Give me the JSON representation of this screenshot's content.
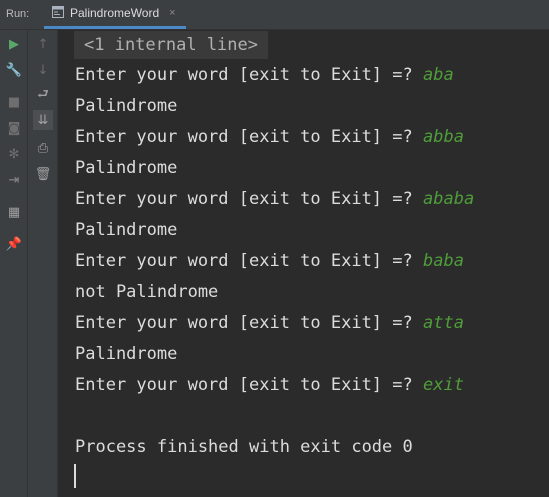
{
  "run": {
    "label": "Run:",
    "tab": {
      "title": "PalindromeWord",
      "close_glyph": "×",
      "icon": "console-icon"
    }
  },
  "left_toolbar": [
    {
      "name": "run-icon",
      "glyph": "▶",
      "color": "#59a869"
    },
    {
      "name": "wrench-icon",
      "glyph": "🔧",
      "color": "#9a9a9a"
    },
    {
      "name": "stop-icon",
      "glyph": "■",
      "color": "#6e6e6e"
    },
    {
      "name": "camera-icon",
      "glyph": "◙",
      "color": "#6e6e6e"
    },
    {
      "name": "bug-icon",
      "glyph": "✻",
      "color": "#6e6e6e"
    },
    {
      "name": "exit-icon",
      "glyph": "⇥",
      "color": "#8a8a8a"
    },
    {
      "name": "layout-icon",
      "glyph": "▦",
      "color": "#a0a0a0"
    },
    {
      "name": "pin-icon",
      "glyph": "📌",
      "color": "#9a9a9a"
    }
  ],
  "second_toolbar": [
    {
      "name": "up-arrow-icon",
      "glyph": "↑",
      "color": "#6b6b6b"
    },
    {
      "name": "down-arrow-icon",
      "glyph": "↓",
      "color": "#6b6b6b"
    },
    {
      "name": "soft-wrap-icon",
      "glyph": "⮐",
      "color": "#a0a0a0"
    },
    {
      "name": "scroll-to-end-icon",
      "glyph": "⇊",
      "color": "#a0a0a0"
    },
    {
      "name": "print-icon",
      "glyph": "⎙",
      "color": "#a0a0a0"
    },
    {
      "name": "trash-icon",
      "glyph": "🗑",
      "color": "#a0a0a0"
    }
  ],
  "console": {
    "fold_text": "<1 internal line>",
    "lines": [
      {
        "text": "Enter your word [exit to Exit] =? ",
        "input": "aba"
      },
      {
        "text": "Palindrome",
        "input": ""
      },
      {
        "text": "Enter your word [exit to Exit] =? ",
        "input": "abba"
      },
      {
        "text": "Palindrome",
        "input": ""
      },
      {
        "text": "Enter your word [exit to Exit] =? ",
        "input": "ababa"
      },
      {
        "text": "Palindrome",
        "input": ""
      },
      {
        "text": "Enter your word [exit to Exit] =? ",
        "input": "baba"
      },
      {
        "text": "not Palindrome",
        "input": ""
      },
      {
        "text": "Enter your word [exit to Exit] =? ",
        "input": "atta"
      },
      {
        "text": "Palindrome",
        "input": ""
      },
      {
        "text": "Enter your word [exit to Exit] =? ",
        "input": "exit"
      },
      {
        "text": "",
        "input": ""
      },
      {
        "text": "Process finished with exit code 0",
        "input": ""
      }
    ],
    "colors": {
      "text": "#dcdcdc",
      "input": "#4f9d3a",
      "background": "#2b2b2b"
    }
  }
}
